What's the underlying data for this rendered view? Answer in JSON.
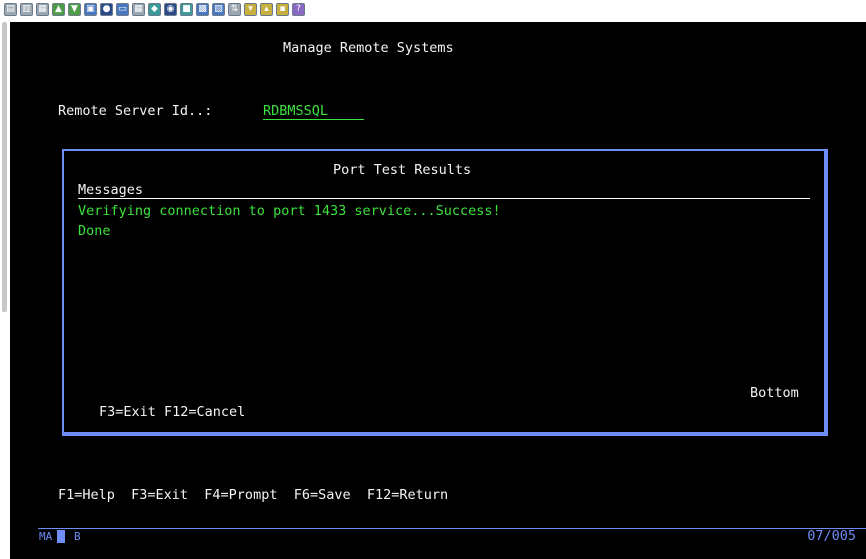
{
  "toolbar": {
    "icons": [
      "copy-icon",
      "paste-icon",
      "paste-special-icon",
      "send-file-icon",
      "receive-file-icon",
      "macro-icon",
      "record-icon",
      "display-icon",
      "keypad-icon",
      "settings-icon",
      "color-icon",
      "session-icon",
      "image-icon",
      "properties-icon",
      "transfer-up-icon",
      "transfer-down-icon",
      "transfer-icon",
      "print-icon",
      "help-icon"
    ]
  },
  "screen": {
    "title": "Manage Remote Systems",
    "remote_server_label": "Remote Server Id..:",
    "remote_server_value": "RDBMSSQL",
    "popup": {
      "title": "Port Test Results",
      "messages_header": "Messages",
      "messages": [
        "Verifying connection to port 1433 service...Success!",
        "Done"
      ],
      "more_indicator": "Bottom",
      "function_keys": "F3=Exit F12=Cancel"
    },
    "function_keys": "F1=Help  F3=Exit  F4=Prompt  F6=Save  F12=Return"
  },
  "status": {
    "mode": "MA",
    "indicator": "B",
    "cursor_position": "07/005"
  },
  "colors": {
    "background": "#000000",
    "text": "#f4f4f4",
    "field": "#3ce23c",
    "border": "#6f8df7"
  }
}
